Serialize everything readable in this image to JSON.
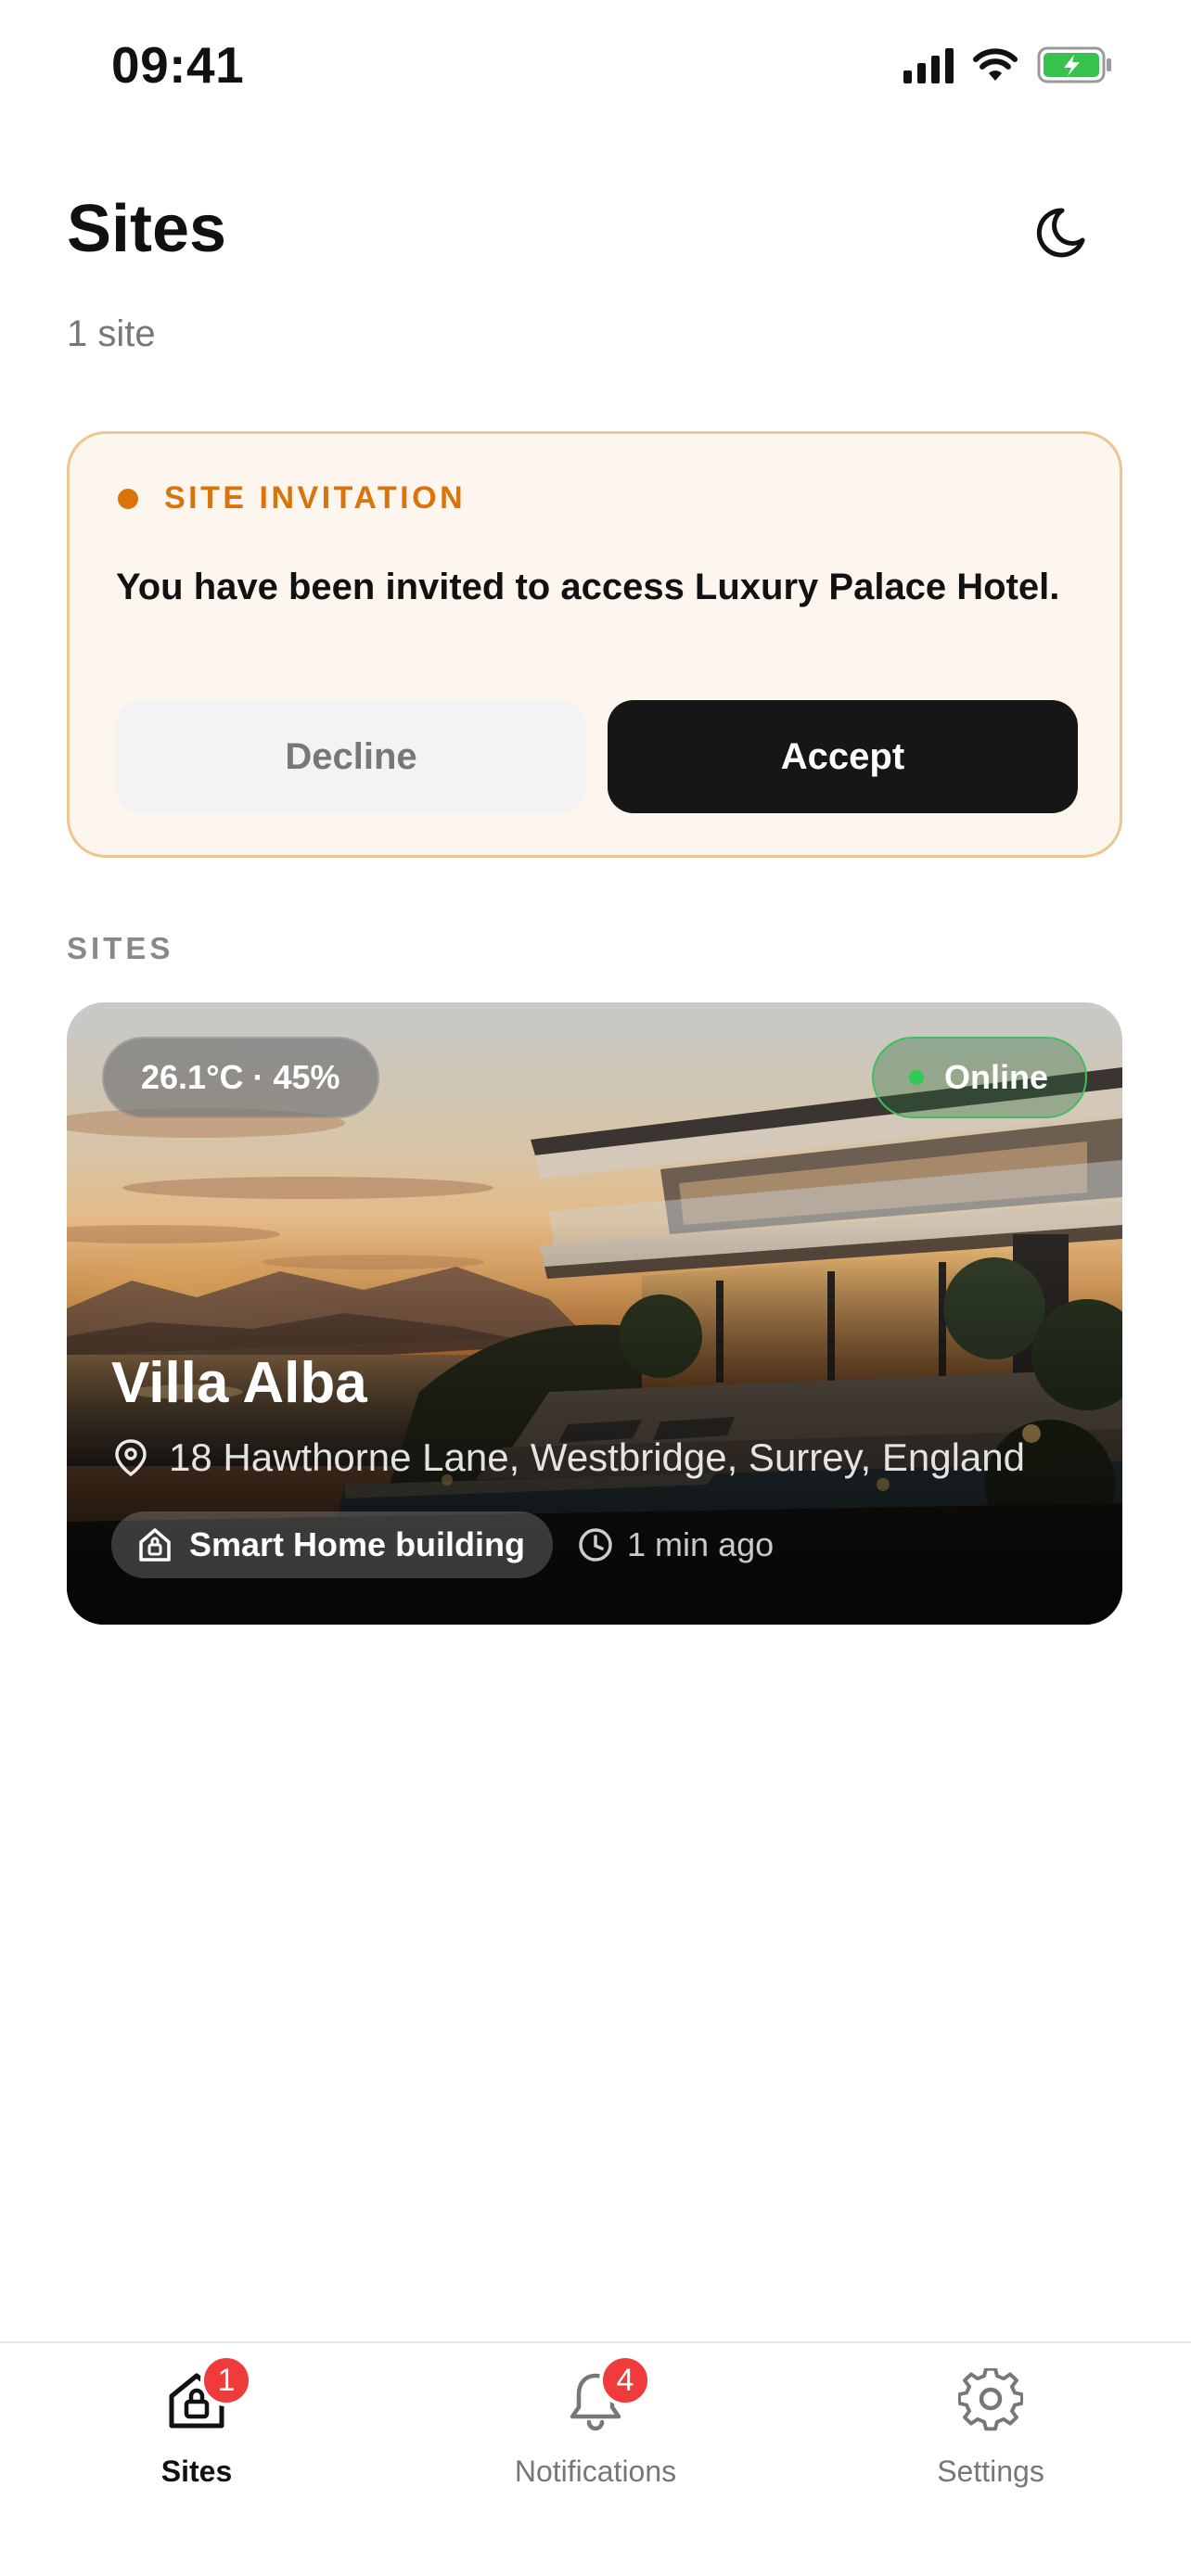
{
  "status_bar": {
    "time": "09:41"
  },
  "header": {
    "title": "Sites",
    "subtitle": "1 site"
  },
  "invitation": {
    "eyebrow": "SITE INVITATION",
    "message": "You have been invited to access Luxury Palace Hotel.",
    "decline_label": "Decline",
    "accept_label": "Accept"
  },
  "sites_section": {
    "label": "SITES",
    "items": [
      {
        "climate": "26.1°C · 45%",
        "status": "Online",
        "name": "Villa Alba",
        "address": "18 Hawthorne Lane, Westbridge, Surrey, England",
        "type": "Smart Home building",
        "updated": "1 min ago"
      }
    ]
  },
  "tab_bar": {
    "tabs": [
      {
        "label": "Sites",
        "badge": "1",
        "icon": "sites-icon",
        "active": true
      },
      {
        "label": "Notifications",
        "badge": "4",
        "icon": "bell-icon",
        "active": false
      },
      {
        "label": "Settings",
        "badge": "",
        "icon": "gear-icon",
        "active": false
      }
    ]
  },
  "colors": {
    "accent_orange": "#d9740b",
    "invite_bg": "#fdf6ee",
    "invite_border": "#edc58f",
    "online_green": "#2ecc55",
    "badge_red": "#ef3b3b",
    "primary_button": "#161616"
  }
}
